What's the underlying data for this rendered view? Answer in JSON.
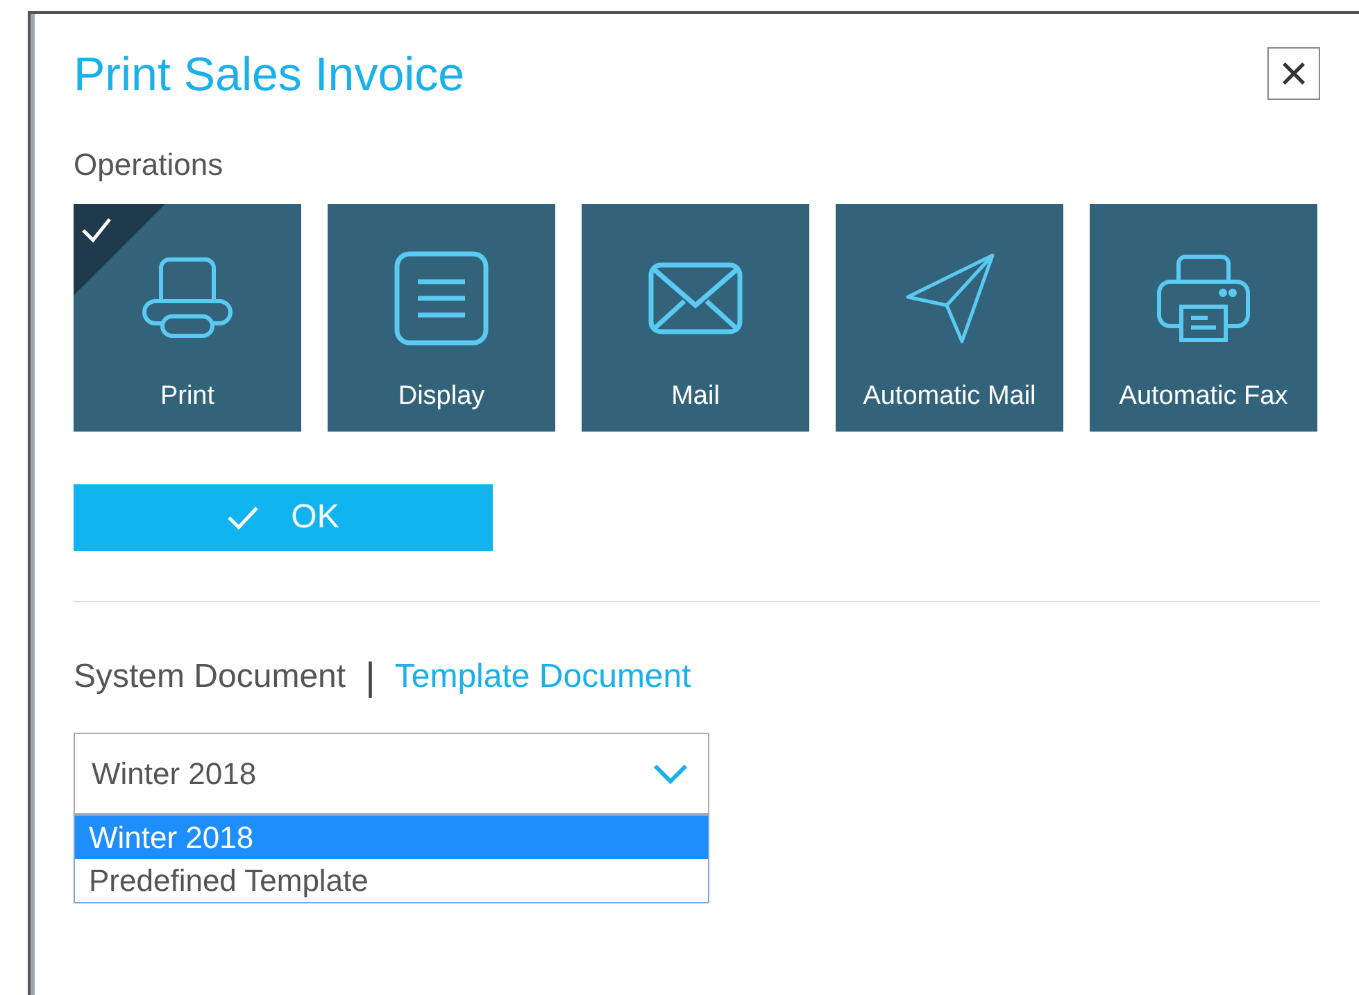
{
  "dialog": {
    "title": "Print Sales Invoice",
    "close_label": "×"
  },
  "operations": {
    "heading": "Operations",
    "items": [
      {
        "label": "Print",
        "kind": "print",
        "selected": true
      },
      {
        "label": "Display",
        "kind": "display",
        "selected": false
      },
      {
        "label": "Mail",
        "kind": "mail",
        "selected": false
      },
      {
        "label": "Automatic Mail",
        "kind": "send",
        "selected": false
      },
      {
        "label": "Automatic Fax",
        "kind": "fax",
        "selected": false
      }
    ]
  },
  "ok_button": {
    "label": "OK"
  },
  "document_tabs": [
    {
      "label": "System Document",
      "selected": false
    },
    {
      "label": "Template Document",
      "selected": true
    }
  ],
  "separator": "|",
  "template_select": {
    "value": "Winter 2018",
    "expanded": true,
    "options": [
      {
        "label": "Winter 2018",
        "selected": true
      },
      {
        "label": "Predefined Template",
        "selected": false
      }
    ]
  }
}
